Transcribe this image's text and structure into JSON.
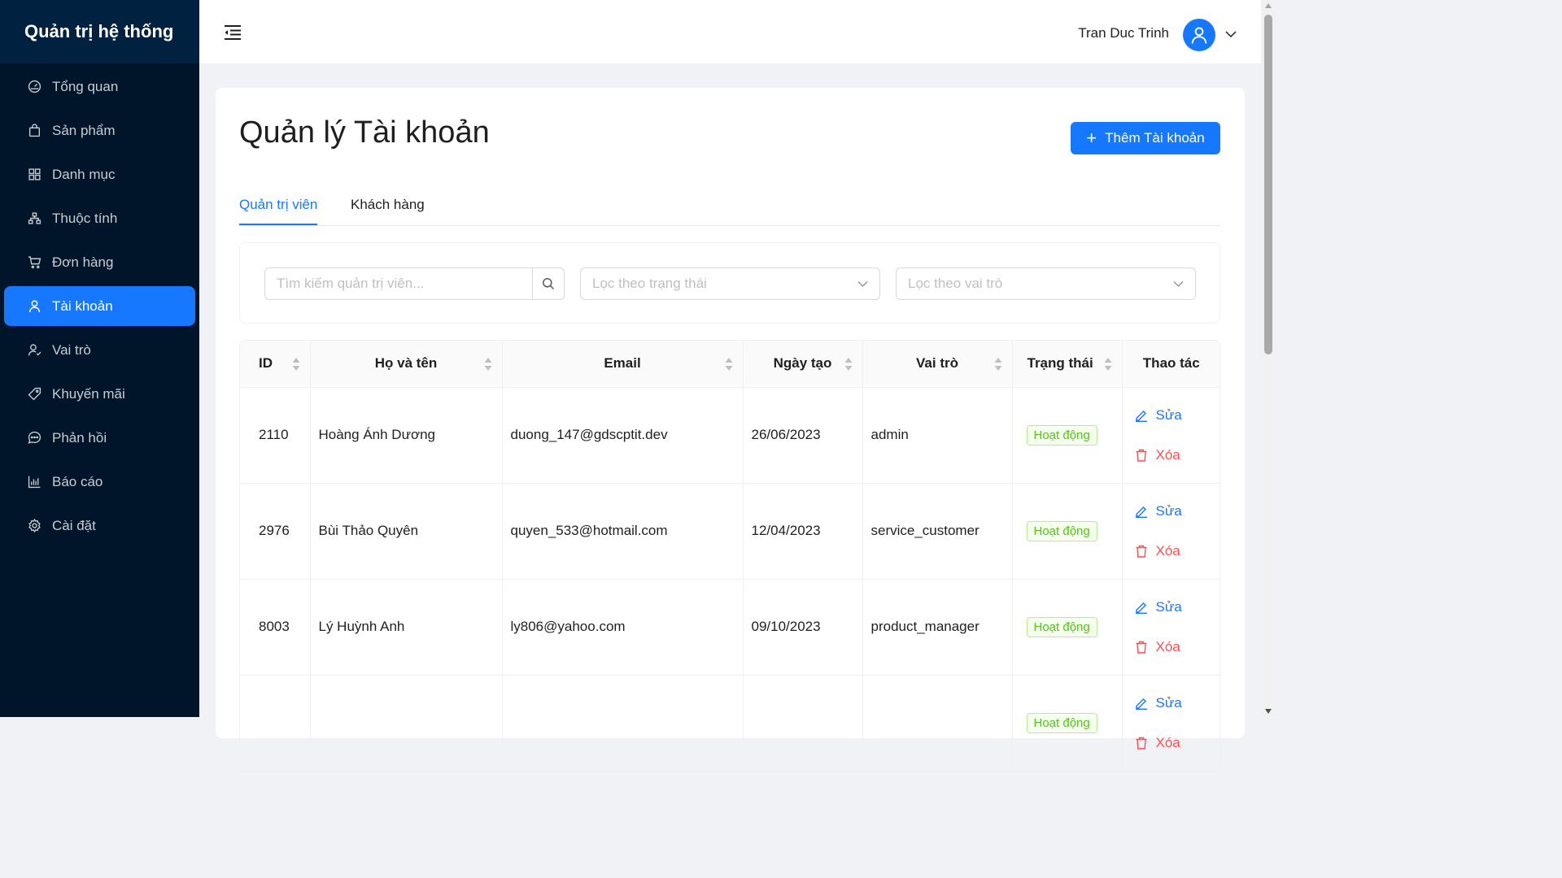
{
  "brand": "Quản trị hệ thống",
  "sidebar": {
    "items": [
      {
        "label": "Tổng quan",
        "icon": "dashboard-icon"
      },
      {
        "label": "Sản phẩm",
        "icon": "shopping-bag-icon"
      },
      {
        "label": "Danh mục",
        "icon": "grid-icon"
      },
      {
        "label": "Thuộc tính",
        "icon": "cluster-icon"
      },
      {
        "label": "Đơn hàng",
        "icon": "cart-icon"
      },
      {
        "label": "Tài khoản",
        "icon": "user-icon",
        "active": true
      },
      {
        "label": "Vai trò",
        "icon": "user-role-icon"
      },
      {
        "label": "Khuyến mãi",
        "icon": "tag-icon"
      },
      {
        "label": "Phản hồi",
        "icon": "message-icon"
      },
      {
        "label": "Báo cáo",
        "icon": "bar-chart-icon"
      },
      {
        "label": "Cài đặt",
        "icon": "gear-icon"
      }
    ]
  },
  "header": {
    "user_name": "Tran Duc Trinh"
  },
  "main": {
    "title": "Quản lý Tài khoản",
    "add_button": "Thêm Tài khoản",
    "tabs": [
      {
        "label": "Quản trị viên",
        "active": true
      },
      {
        "label": "Khách hàng",
        "active": false
      }
    ],
    "filters": {
      "search_placeholder": "Tìm kiếm quản trị viên...",
      "status_placeholder": "Lọc theo trạng thái",
      "role_placeholder": "Lọc theo vai trò"
    },
    "table": {
      "columns": [
        "ID",
        "Họ và tên",
        "Email",
        "Ngày tạo",
        "Vai trò",
        "Trạng thái",
        "Thao tác"
      ],
      "rows": [
        {
          "id": "2110",
          "name": "Hoàng Ánh Dương",
          "email": "duong_147@gdscptit.dev",
          "created": "26/06/2023",
          "role": "admin",
          "status": "Hoạt động"
        },
        {
          "id": "2976",
          "name": "Bùi Thảo Quyên",
          "email": "quyen_533@hotmail.com",
          "created": "12/04/2023",
          "role": "service_customer",
          "status": "Hoạt động"
        },
        {
          "id": "8003",
          "name": "Lý Huỳnh Anh",
          "email": "ly806@yahoo.com",
          "created": "09/10/2023",
          "role": "product_manager",
          "status": "Hoạt động"
        },
        {
          "id": "",
          "name": "",
          "email": "",
          "created": "",
          "role": "",
          "status": "Hoạt động"
        }
      ],
      "edit_label": "Sửa",
      "delete_label": "Xóa"
    }
  },
  "colors": {
    "primary": "#1677ff",
    "sidebar_bg": "#001529",
    "success": "#52c41a",
    "danger": "#ff4d4f"
  }
}
